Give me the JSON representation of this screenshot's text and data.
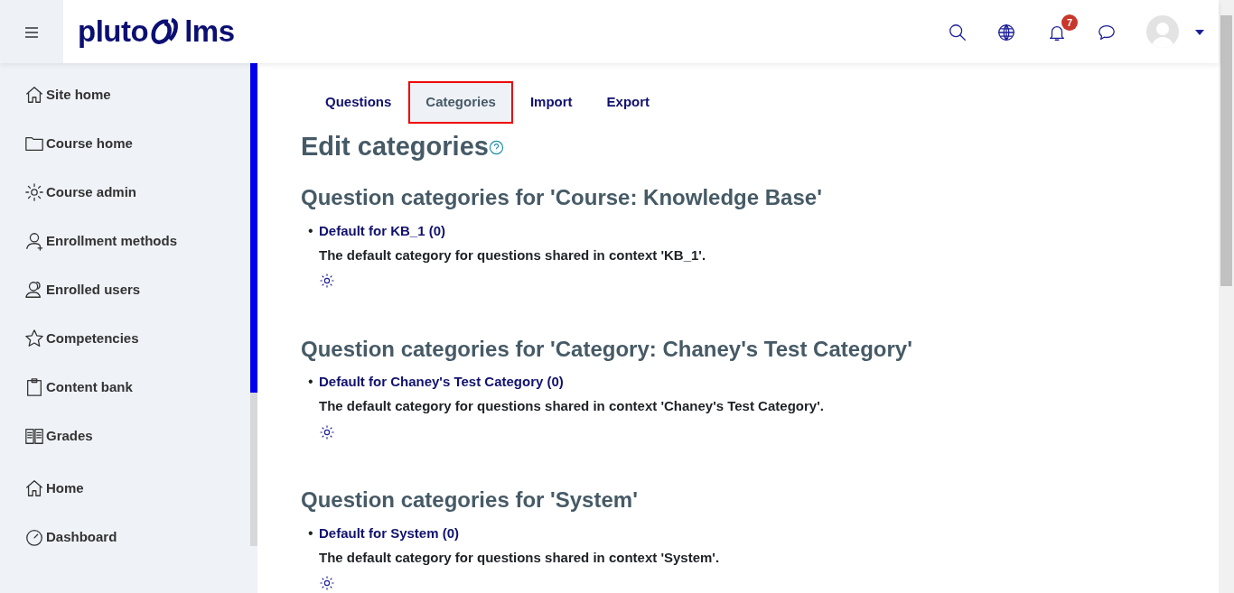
{
  "header": {
    "logo": {
      "left": "pluto",
      "right": "lms"
    },
    "notification_count": "7"
  },
  "sidebar": {
    "items": [
      {
        "label": "Site home"
      },
      {
        "label": "Course home"
      },
      {
        "label": "Course admin"
      },
      {
        "label": "Enrollment methods"
      },
      {
        "label": "Enrolled users"
      },
      {
        "label": "Competencies"
      },
      {
        "label": "Content bank"
      },
      {
        "label": "Grades"
      },
      {
        "label": "Home"
      },
      {
        "label": "Dashboard"
      }
    ]
  },
  "tabs": [
    {
      "label": "Questions",
      "selected": false
    },
    {
      "label": "Categories",
      "selected": true
    },
    {
      "label": "Import",
      "selected": false
    },
    {
      "label": "Export",
      "selected": false
    }
  ],
  "page_title": "Edit categories",
  "sections": [
    {
      "heading": "Question categories for 'Course: Knowledge Base'",
      "categories": [
        {
          "bullet": "•",
          "link": "Default for KB_1 (0)",
          "description": "The default category for questions shared in context 'KB_1'."
        }
      ]
    },
    {
      "heading": "Question categories for 'Category: Chaney's Test Category'",
      "categories": [
        {
          "bullet": "•",
          "link": "Default for Chaney's Test Category (0)",
          "description": "The default category for questions shared in context 'Chaney's Test Category'."
        }
      ]
    },
    {
      "heading": "Question categories for 'System'",
      "categories": [
        {
          "bullet": "•",
          "link": "Default for System (0)",
          "description": "The default category for questions shared in context 'System'."
        }
      ]
    }
  ]
}
